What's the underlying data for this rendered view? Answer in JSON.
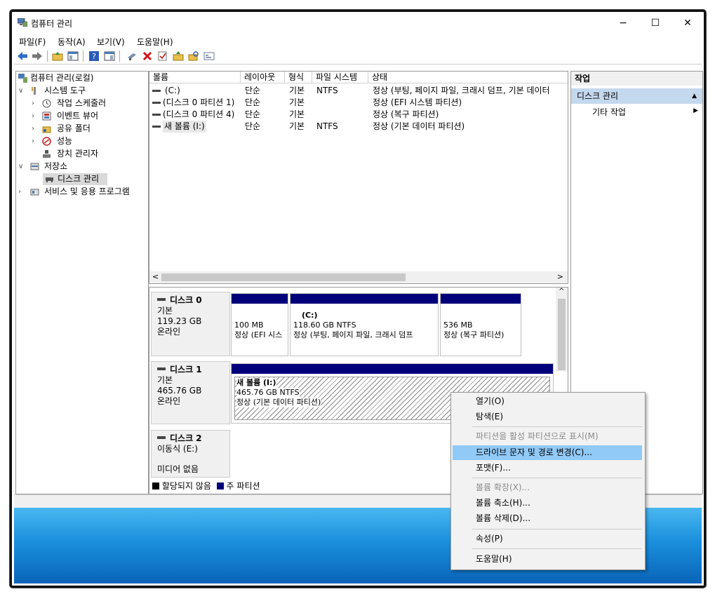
{
  "window": {
    "title": "컴퓨터 관리",
    "min": "−",
    "max": "☐",
    "close": "✕"
  },
  "menu": [
    "파일(F)",
    "동작(A)",
    "보기(V)",
    "도움말(H)"
  ],
  "tree": {
    "root": "컴퓨터 관리(로컬)",
    "system_tools": "시스템 도구",
    "task_scheduler": "작업 스케줄러",
    "event_viewer": "이벤트 뷰어",
    "shared_folders": "공유 폴더",
    "performance": "성능",
    "device_manager": "장치 관리자",
    "storage": "저장소",
    "disk_management": "디스크 관리",
    "services_apps": "서비스 및 응용 프로그램"
  },
  "volume_list": {
    "columns": [
      "볼륨",
      "레이아웃",
      "형식",
      "파일 시스템",
      "상태"
    ],
    "rows": [
      {
        "volume": "(C:)",
        "layout": "단순",
        "type": "기본",
        "fs": "NTFS",
        "status": "정상 (부팅, 페이지 파일, 크래시 덤프, 기본 데이터"
      },
      {
        "volume": "(디스크 0 파티션 1)",
        "layout": "단순",
        "type": "기본",
        "fs": "",
        "status": "정상 (EFI 시스템 파티션)"
      },
      {
        "volume": "(디스크 0 파티션 4)",
        "layout": "단순",
        "type": "기본",
        "fs": "",
        "status": "정상 (복구 파티션)"
      },
      {
        "volume": "새 볼륨 (I:)",
        "layout": "단순",
        "type": "기본",
        "fs": "NTFS",
        "status": "정상 (기본 데이터 파티션)"
      }
    ]
  },
  "disks": {
    "disk0": {
      "name": "디스크 0",
      "type": "기본",
      "size": "119.23 GB",
      "state": "온라인",
      "p1_size": "100 MB",
      "p1_status": "정상 (EFI 시스",
      "p2_name": "(C:)",
      "p2_size": "118.60 GB NTFS",
      "p2_status": "정상 (부팅, 페이지 파일, 크래시 덤프",
      "p3_size": "536 MB",
      "p3_status": "정상 (복구 파티션)"
    },
    "disk1": {
      "name": "디스크 1",
      "type": "기본",
      "size": "465.76 GB",
      "state": "온라인",
      "p_name": "새 볼륨  (I:)",
      "p_size": "465.76 GB NTFS",
      "p_status": "정상 (기본 데이터 파티션)"
    },
    "disk2": {
      "name": "디스크 2",
      "type": "이동식 (E:)",
      "state": "미디어 없음"
    }
  },
  "legend": {
    "unallocated": "할당되지 않음",
    "primary": "주 파티션"
  },
  "actions": {
    "header": "작업",
    "section": "디스크 관리",
    "more": "기타 작업"
  },
  "context_menu": {
    "open": "열기(O)",
    "explore": "탐색(E)",
    "mark_active": "파티션을 활성 파티션으로 표시(M)",
    "change_letter": "드라이브 문자 및 경로 변경(C)...",
    "format": "포맷(F)...",
    "extend": "볼륨 확장(X)...",
    "shrink": "볼륨 축소(H)...",
    "delete": "볼륨 삭제(D)...",
    "properties": "속성(P)",
    "help": "도움말(H)"
  },
  "colors": {
    "primary_partition": "#00007a",
    "highlight": "#91c9f7",
    "action_section": "#c4d8ee"
  }
}
